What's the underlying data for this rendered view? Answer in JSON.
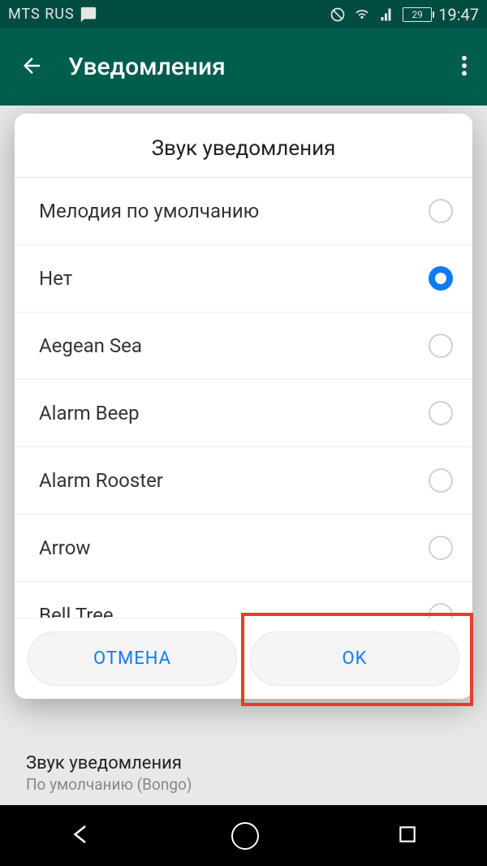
{
  "statusbar": {
    "carrier": "MTS RUS",
    "battery": "29",
    "time": "19:47"
  },
  "appbar": {
    "title": "Уведомления"
  },
  "dialog": {
    "title": "Звук уведомления",
    "options": [
      {
        "label": "Мелодия по умолчанию",
        "selected": false
      },
      {
        "label": "Нет",
        "selected": true
      },
      {
        "label": "Aegean Sea",
        "selected": false
      },
      {
        "label": "Alarm Beep",
        "selected": false
      },
      {
        "label": "Alarm Rooster",
        "selected": false
      },
      {
        "label": "Arrow",
        "selected": false
      },
      {
        "label": "Bell Tree",
        "selected": false
      }
    ],
    "cancel": "ОТМЕНА",
    "ok": "OK"
  },
  "background_item": {
    "title": "Звук уведомления",
    "subtitle": "По умолчанию (Bongo)"
  }
}
